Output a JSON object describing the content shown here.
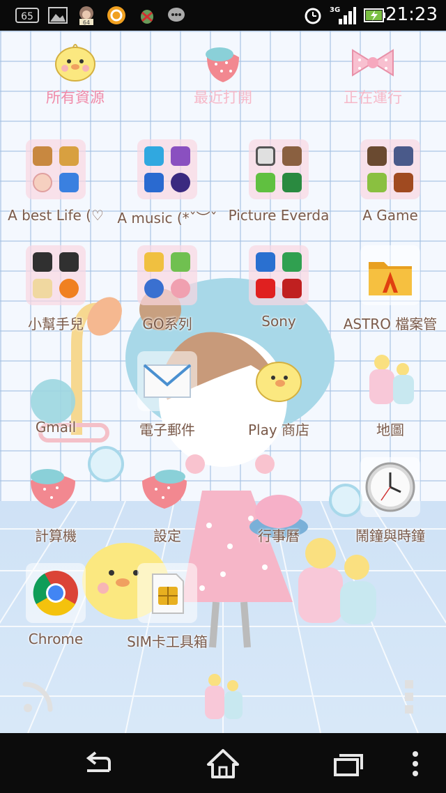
{
  "status_bar": {
    "notification_icons": [
      "sim-65-icon",
      "gallery-icon",
      "monkey-64-icon",
      "orange-app-icon",
      "android-bug-icon",
      "chat-bubble-icon"
    ],
    "badge_a": "65",
    "badge_b": "64",
    "network": "3G",
    "time": "21:23"
  },
  "tabs": [
    {
      "label": "所有資源",
      "color": "#f08aa8"
    },
    {
      "label": "最近打開",
      "color": "#f6b8c8"
    },
    {
      "label": "正在運行",
      "color": "#f6b8c8"
    }
  ],
  "apps": [
    {
      "label": "A best Life (♡",
      "type": "folder",
      "icons": [
        "line-icon",
        "cafe-icon",
        "mirror-icon",
        "messenger-icon"
      ]
    },
    {
      "label": "A music (*ˇ︶ˇ",
      "type": "folder",
      "icons": [
        "kkbox-icon",
        "walkman-icon",
        "music-store-icon",
        "music-note-icon"
      ]
    },
    {
      "label": "Picture Everda",
      "type": "folder",
      "icons": [
        "camera-icon",
        "instagram-icon",
        "line-camera-icon",
        "camera360-icon"
      ]
    },
    {
      "label": "A Game",
      "type": "folder",
      "icons": [
        "game-1-icon",
        "game-2-icon",
        "game-3-icon",
        "game-4-icon"
      ]
    },
    {
      "label": "小幫手兒",
      "type": "folder",
      "icons": [
        "app-a-icon",
        "app-b-icon",
        "app-c-icon",
        "avast-icon"
      ]
    },
    {
      "label": "GO系列",
      "type": "folder",
      "icons": [
        "go-weather-icon",
        "go-locker-icon",
        "go-launcher-icon",
        "go-theme-icon"
      ]
    },
    {
      "label": "Sony",
      "type": "folder",
      "icons": [
        "sony-folder-icon",
        "sony-select-icon",
        "flipboard-icon",
        "mcafee-icon"
      ]
    },
    {
      "label": "ASTRO 檔案管",
      "type": "app",
      "icon": "astro-folder-icon"
    },
    {
      "label": "Gmail",
      "type": "app",
      "icon": "gmail-icon"
    },
    {
      "label": "電子郵件",
      "type": "app",
      "icon": "email-icon"
    },
    {
      "label": "Play 商店",
      "type": "app",
      "icon": "play-store-icon"
    },
    {
      "label": "地圖",
      "type": "app",
      "icon": "maps-icon"
    },
    {
      "label": "計算機",
      "type": "app",
      "icon": "calculator-icon"
    },
    {
      "label": "設定",
      "type": "app",
      "icon": "settings-icon"
    },
    {
      "label": "行事曆",
      "type": "app",
      "icon": "calendar-icon"
    },
    {
      "label": "鬧鐘與時鐘",
      "type": "app",
      "icon": "clock-icon"
    },
    {
      "label": "Chrome",
      "type": "app",
      "icon": "chrome-icon"
    },
    {
      "label": "SIM卡工具箱",
      "type": "app",
      "icon": "sim-toolkit-icon"
    }
  ],
  "dock": {
    "left_icon": "wifi-arc-icon",
    "center_icon": "bottles-home-icon",
    "right_icon": "more-dots-icon"
  },
  "nav": {
    "back": "back-icon",
    "home": "home-icon",
    "recents": "recents-icon",
    "menu": "menu-icon"
  },
  "colors": {
    "status_bg": "#0a0a0a",
    "label_text": "#7a5a4a",
    "tab_active": "#f08aa8"
  }
}
